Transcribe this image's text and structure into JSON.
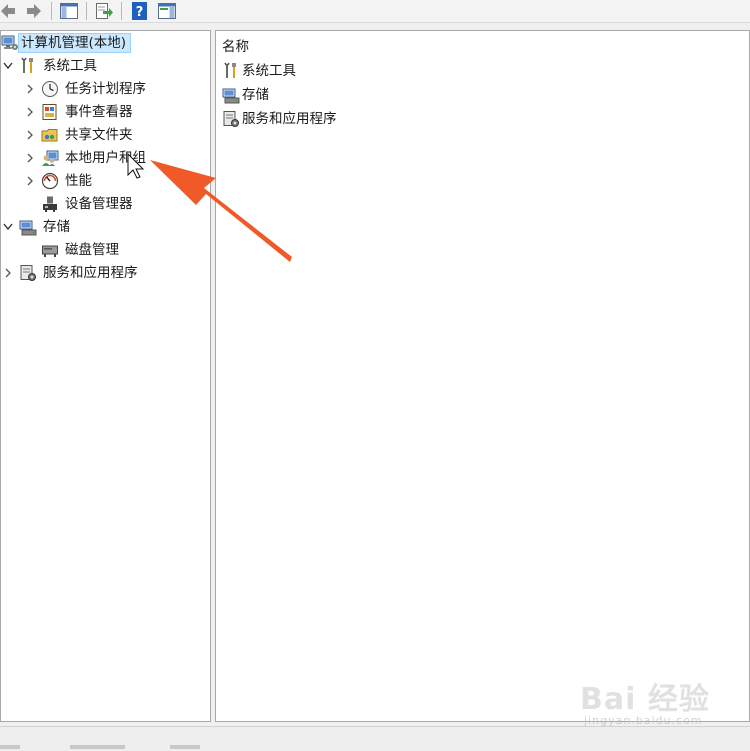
{
  "colors": {
    "selection": "#cce8ff",
    "selection_border": "#99d1ff",
    "arrow": "#f05a28",
    "pane_border": "#a9a9a9"
  },
  "toolbar": {
    "buttons": [
      {
        "name": "back-icon"
      },
      {
        "name": "forward-icon"
      },
      {
        "name": "show-hide-console-tree-icon"
      },
      {
        "name": "export-list-icon"
      },
      {
        "name": "help-icon"
      },
      {
        "name": "show-hide-action-pane-icon"
      }
    ]
  },
  "tree": {
    "root": {
      "label": "计算机管理(本地)",
      "icon": "computer-management-icon"
    },
    "system_tools": {
      "label": "系统工具",
      "icon": "tools-icon",
      "children": [
        {
          "label": "任务计划程序",
          "icon": "clock-icon"
        },
        {
          "label": "事件查看器",
          "icon": "event-viewer-icon"
        },
        {
          "label": "共享文件夹",
          "icon": "shared-folder-icon"
        },
        {
          "label": "本地用户和组",
          "icon": "users-icon"
        },
        {
          "label": "性能",
          "icon": "performance-icon"
        },
        {
          "label": "设备管理器",
          "icon": "device-manager-icon"
        }
      ]
    },
    "storage": {
      "label": "存储",
      "icon": "storage-icon",
      "children": [
        {
          "label": "磁盘管理",
          "icon": "disk-icon"
        }
      ]
    },
    "services": {
      "label": "服务和应用程序",
      "icon": "services-icon"
    }
  },
  "list": {
    "column_name": "名称",
    "items": [
      {
        "label": "系统工具",
        "icon": "tools-icon"
      },
      {
        "label": "存储",
        "icon": "storage-icon"
      },
      {
        "label": "服务和应用程序",
        "icon": "services-icon"
      }
    ]
  },
  "watermark": {
    "brand": "Bai 经验",
    "url": "jingyan.baidu.com"
  }
}
